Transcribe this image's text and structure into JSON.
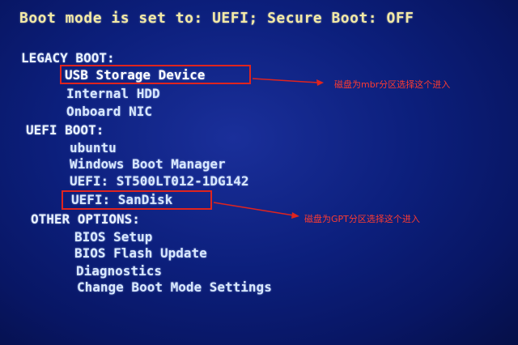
{
  "header": {
    "text": "Boot mode is set to: UEFI; Secure Boot: OFF"
  },
  "legacy_boot": {
    "title": "LEGACY BOOT:",
    "items": [
      {
        "label": "USB Storage Device"
      },
      {
        "label": "Internal HDD"
      },
      {
        "label": "Onboard NIC"
      }
    ]
  },
  "uefi_boot": {
    "title": "UEFI BOOT:",
    "items": [
      {
        "label": "ubuntu"
      },
      {
        "label": "Windows Boot Manager"
      },
      {
        "label": "UEFI: ST500LT012-1DG142"
      },
      {
        "label": "UEFI: SanDisk"
      }
    ]
  },
  "other_options": {
    "title": "OTHER OPTIONS:",
    "items": [
      {
        "label": "BIOS Setup"
      },
      {
        "label": "BIOS Flash Update"
      },
      {
        "label": "Diagnostics"
      },
      {
        "label": "Change Boot Mode Settings"
      }
    ]
  },
  "annotations": {
    "mbr_note": "磁盘为mbr分区选择这个进入",
    "gpt_note": "磁盘为GPT分区选择这个进入"
  },
  "colors": {
    "background": "#0c1f7c",
    "header_text": "#f3e9a6",
    "menu_text": "#d8e8ff",
    "annotation_red": "#e0241e"
  }
}
